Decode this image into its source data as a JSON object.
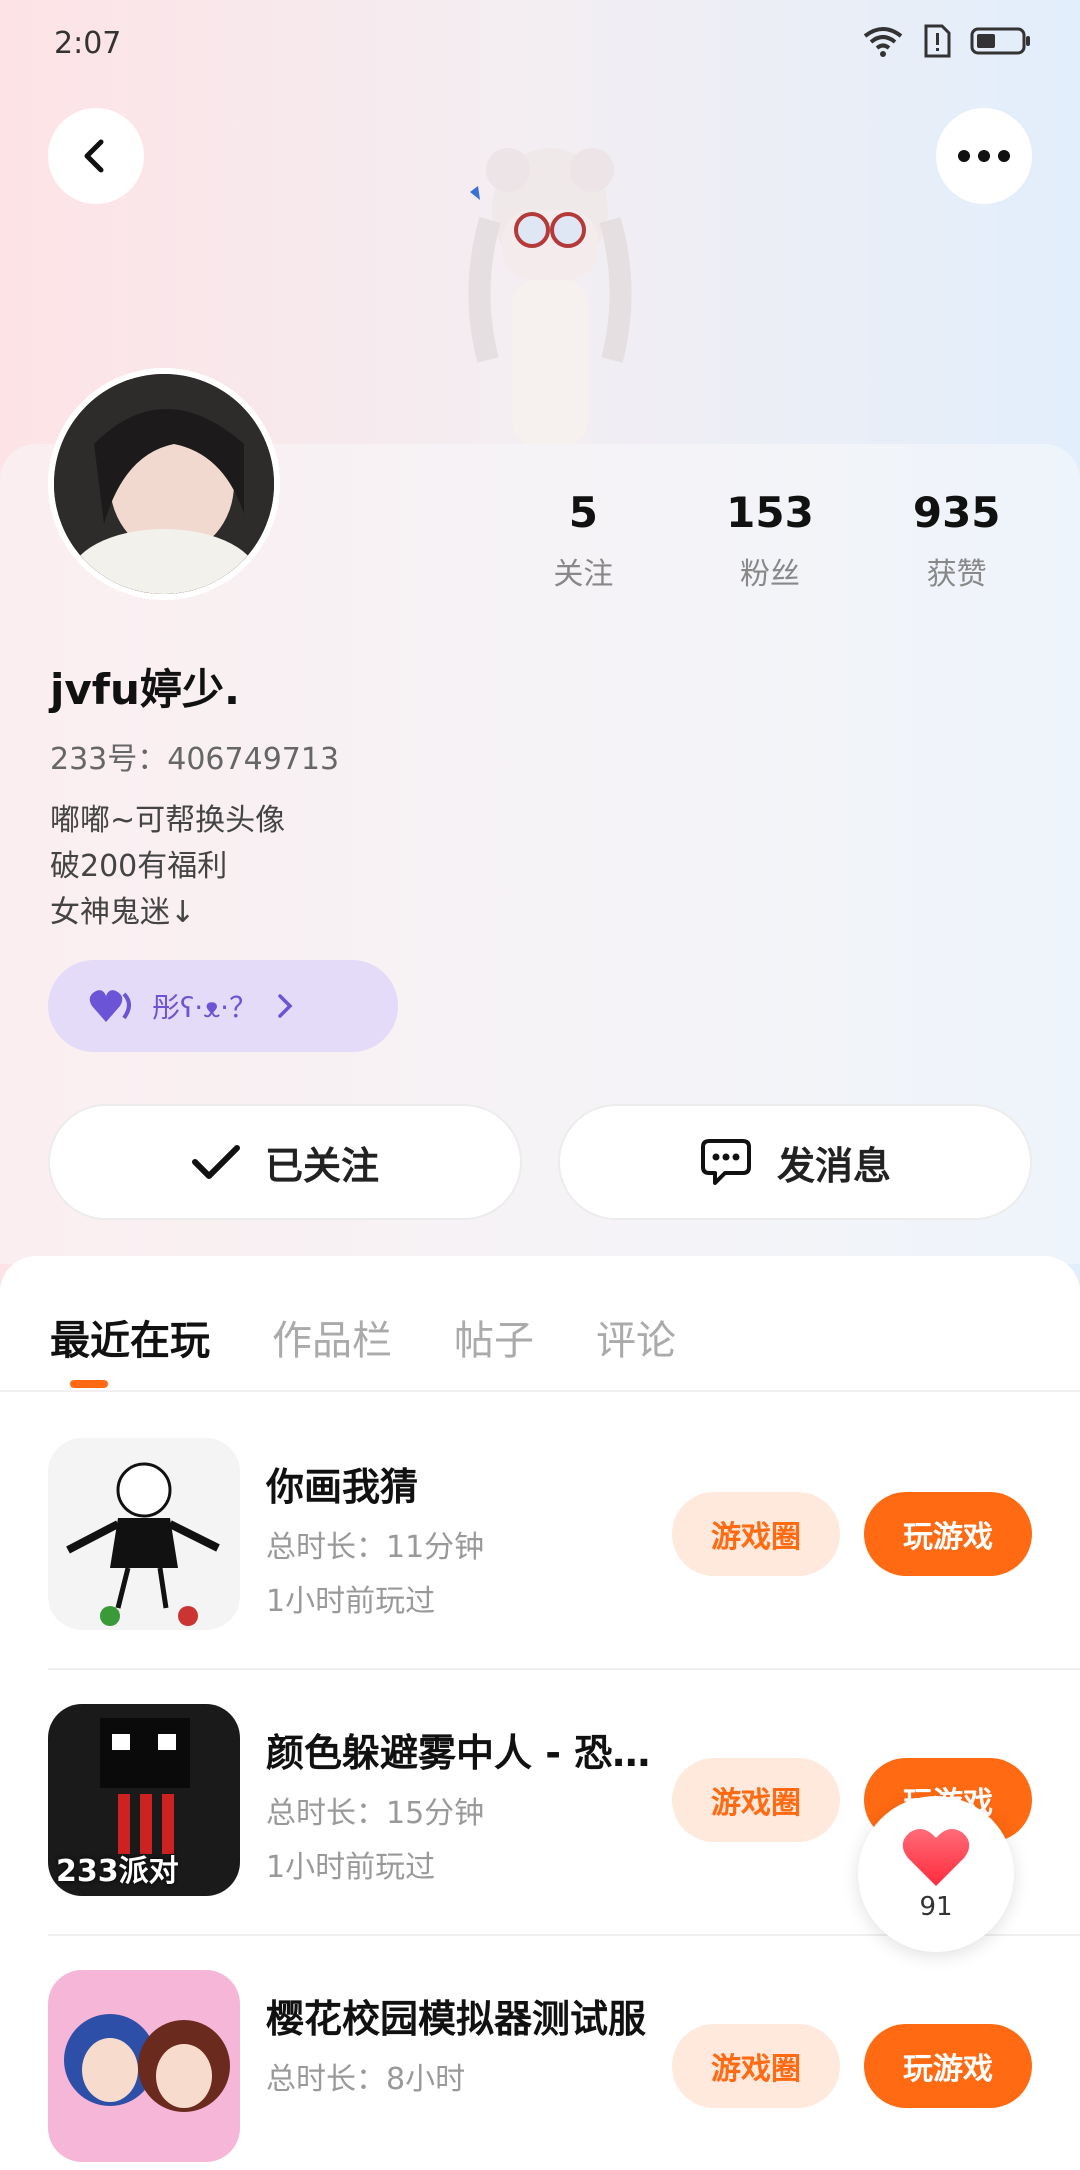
{
  "status": {
    "time": "2:07"
  },
  "profile": {
    "name": "jvfu婷少.",
    "id_line": "233号：406749713",
    "bio": [
      "嘟嘟~可帮换头像",
      "破200有福利",
      "女神鬼迷↓"
    ],
    "group_label": "彤ʕ·ᴥ·？",
    "stats": [
      {
        "num": "5",
        "label": "关注"
      },
      {
        "num": "153",
        "label": "粉丝"
      },
      {
        "num": "935",
        "label": "获赞"
      }
    ]
  },
  "actions": {
    "follow_label": "已关注",
    "message_label": "发消息"
  },
  "tabs": [
    {
      "label": "最近在玩",
      "active": true
    },
    {
      "label": "作品栏",
      "active": false
    },
    {
      "label": "帖子",
      "active": false
    },
    {
      "label": "评论",
      "active": false
    }
  ],
  "games": [
    {
      "title": "你画我猜",
      "duration": "总时长：11分钟",
      "last_played": "1小时前玩过",
      "circle_label": "游戏圈",
      "play_label": "玩游戏"
    },
    {
      "title": "颜色躲避雾中人 - 恐怖...",
      "duration": "总时长：15分钟",
      "last_played": "1小时前玩过",
      "circle_label": "游戏圈",
      "play_label": "玩游戏",
      "icon_text": "233派对"
    },
    {
      "title": "樱花校园模拟器测试服",
      "duration": "总时长：8小时",
      "last_played": "",
      "circle_label": "游戏圈",
      "play_label": "玩游戏"
    }
  ],
  "heart": {
    "count": "91"
  },
  "colors": {
    "accent": "#ff6a12",
    "group_bg": "#e3dbf7",
    "group_text": "#6c54d6"
  }
}
